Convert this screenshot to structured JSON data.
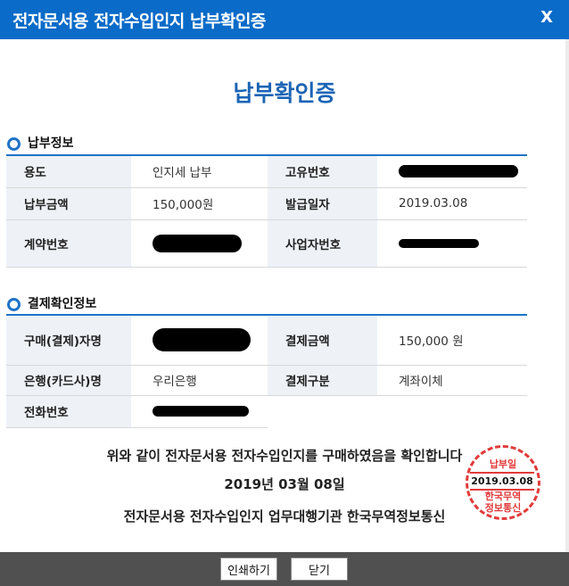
{
  "window": {
    "title": "전자문서용 전자수입인지 납부확인증",
    "close_label": "X"
  },
  "heading": "납부확인증",
  "payment_section": {
    "title": "납부정보",
    "rows": [
      {
        "label1": "용도",
        "value1": "인지세 납부",
        "label2": "고유번호",
        "value2": ""
      },
      {
        "label1": "납부금액",
        "value1": "150,000원",
        "label2": "발급일자",
        "value2": "2019.03.08"
      },
      {
        "label1": "계약번호",
        "value1": "",
        "label2": "사업자번호",
        "value2": ""
      }
    ]
  },
  "settlement_section": {
    "title": "결제확인정보",
    "rows": [
      {
        "label1": "구매(결제)자명",
        "value1": "",
        "label2": "결제금액",
        "value2": "150,000 원"
      },
      {
        "label1": "은행(카드사)명",
        "value1": "우리은행",
        "label2": "결제구분",
        "value2": "계좌이체"
      },
      {
        "label1": "전화번호",
        "value1": ""
      }
    ]
  },
  "confirmation": {
    "line1": "위와 같이 전자문서용 전자수입인지를 구매하였음을 확인합니다",
    "line2": "2019년 03월 08일",
    "line3": "전자문서용 전자수입인지 업무대행기관 한국무역정보통신"
  },
  "stamp": {
    "label": "납부일",
    "date": "2019.03.08",
    "org_line1": "한국무역",
    "org_line2": "정보통신"
  },
  "buttons": {
    "print": "인쇄하기",
    "close": "닫기"
  }
}
